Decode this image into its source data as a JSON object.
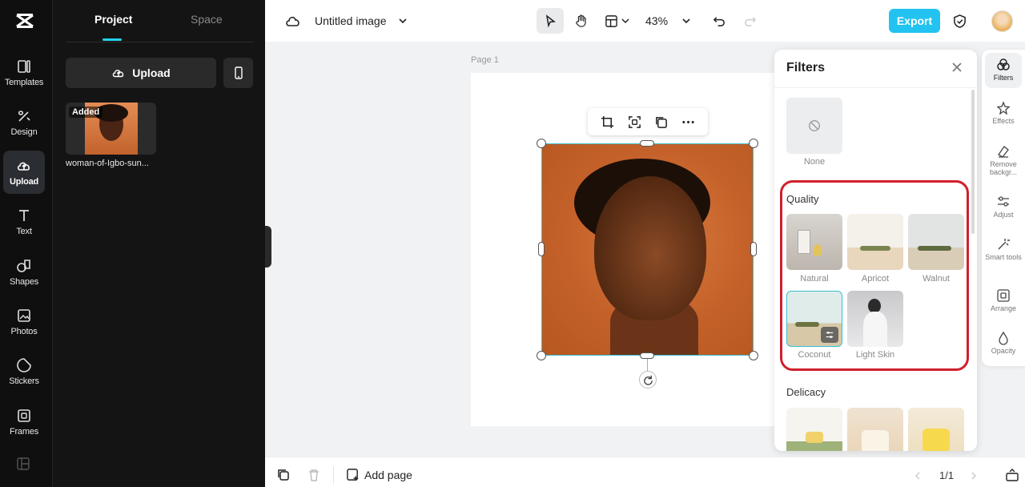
{
  "rail": {
    "items": [
      {
        "label": "Templates",
        "icon": "templates-icon"
      },
      {
        "label": "Design",
        "icon": "design-icon"
      },
      {
        "label": "Upload",
        "icon": "upload-cloud-icon",
        "active": true
      },
      {
        "label": "Text",
        "icon": "text-icon"
      },
      {
        "label": "Shapes",
        "icon": "shapes-icon"
      },
      {
        "label": "Photos",
        "icon": "photos-icon"
      },
      {
        "label": "Stickers",
        "icon": "stickers-icon"
      },
      {
        "label": "Frames",
        "icon": "frames-icon"
      }
    ]
  },
  "panel": {
    "tabs": [
      "Project",
      "Space"
    ],
    "upload_label": "Upload",
    "asset": {
      "badge": "Added",
      "name": "woman-of-Igbo-sun..."
    }
  },
  "topbar": {
    "title": "Untitled image",
    "zoom": "43%",
    "export_label": "Export"
  },
  "canvas": {
    "page_label": "Page 1"
  },
  "filters": {
    "title": "Filters",
    "none_label": "None",
    "sections": [
      {
        "name": "Quality",
        "items": [
          "Natural",
          "Apricot",
          "Walnut",
          "Coconut",
          "Light Skin"
        ]
      },
      {
        "name": "Delicacy"
      }
    ],
    "highlight_color": "#d11f2c"
  },
  "right_rail": {
    "items": [
      {
        "label": "Filters",
        "active": true
      },
      {
        "label": "Effects"
      },
      {
        "label": "Remove backgr..."
      },
      {
        "label": "Adjust"
      },
      {
        "label": "Smart tools"
      },
      {
        "label": "Arrange"
      },
      {
        "label": "Opacity"
      }
    ]
  },
  "bottombar": {
    "add_page": "Add page",
    "page_count": "1/1"
  },
  "colors": {
    "accent": "#22c3f0",
    "selection": "#39c0cf"
  }
}
